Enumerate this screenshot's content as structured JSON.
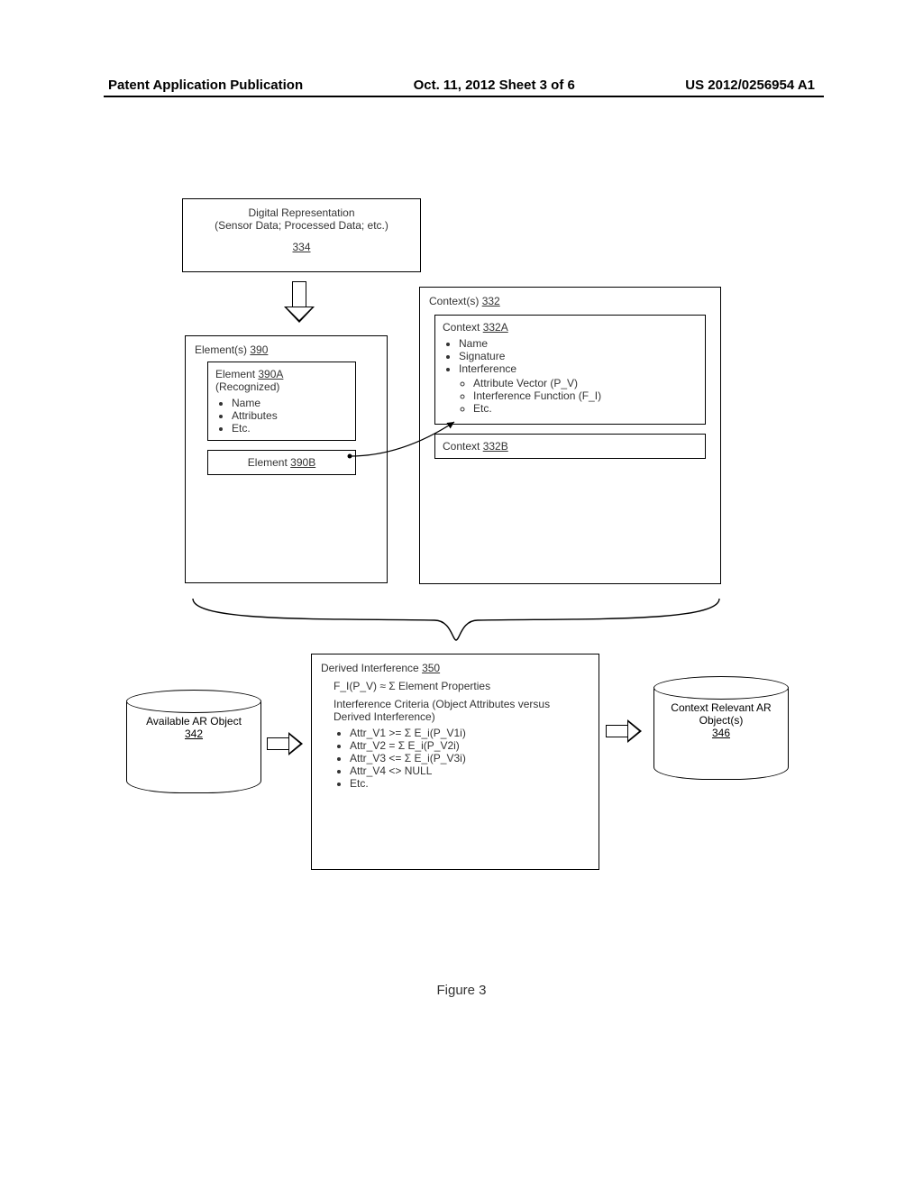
{
  "header": {
    "left": "Patent Application Publication",
    "center": "Oct. 11, 2012  Sheet 3 of 6",
    "right": "US 2012/0256954 A1"
  },
  "boxes": {
    "digrep": {
      "line1": "Digital Representation",
      "line2": "(Sensor Data; Processed Data; etc.)",
      "ref": "334"
    },
    "elements": {
      "title": "Element(s)",
      "ref": "390",
      "a": {
        "title": "Element",
        "ref": "390A",
        "sub": "(Recognized)",
        "items": [
          "Name",
          "Attributes",
          "Etc."
        ]
      },
      "b": {
        "title": "Element",
        "ref": "390B"
      }
    },
    "contexts": {
      "title": "Context(s)",
      "ref": "332",
      "a": {
        "title": "Context",
        "ref": "332A",
        "items": [
          "Name",
          "Signature",
          "Interference"
        ],
        "sub_items": [
          "Attribute Vector (P_V)",
          "Interference Function (F_I)",
          "Etc."
        ]
      },
      "b": {
        "title": "Context",
        "ref": "332B"
      }
    },
    "derived": {
      "title": "Derived Interference",
      "ref": "350",
      "eq": "F_I(P_V) ≈ Σ Element Properties",
      "criteria_label": "Interference Criteria (Object Attributes versus Derived Interference)",
      "criteria": [
        "Attr_V1 >= Σ E_i(P_V1i)",
        "Attr_V2 = Σ E_i(P_V2i)",
        "Attr_V3 <= Σ E_i(P_V3i)",
        "Attr_V4 <> NULL",
        "Etc."
      ]
    },
    "cyl_left": {
      "label": "Available AR Object",
      "ref": "342"
    },
    "cyl_right": {
      "label": "Context Relevant AR Object(s)",
      "ref": "346"
    }
  },
  "figure_label": "Figure 3"
}
